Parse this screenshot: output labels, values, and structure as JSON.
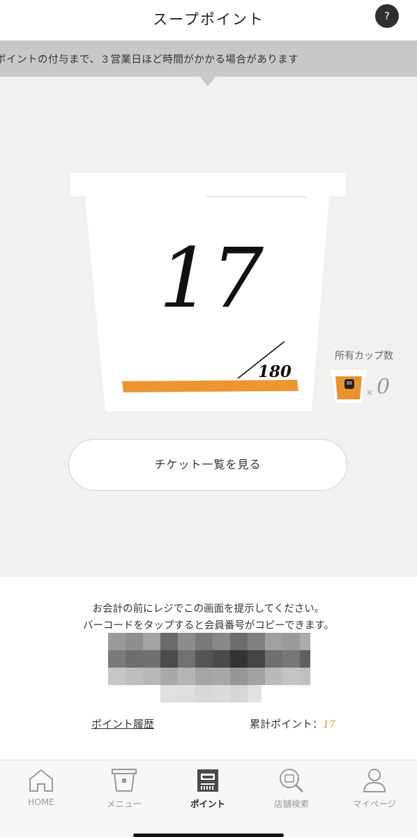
{
  "header": {
    "title": "スープポイント",
    "help_label": "?"
  },
  "notice": {
    "text": "ポイントの付与まで、３営業日ほど時間がかかる場合があります"
  },
  "points": {
    "current": "17",
    "goal": "180",
    "progress_fraction": 0.094
  },
  "cups": {
    "label": "所有カップ数",
    "multiplier": "×",
    "count": "0"
  },
  "ticket_button": {
    "label": "チケット一覧を見る"
  },
  "instruction": {
    "line1": "お会計の前にレジでこの画面を提示してください。",
    "line2": "バーコードをタップすると会員番号がコピーできます。"
  },
  "footer_links": {
    "history_label": "ポイント履歴",
    "total_label": "累計ポイント：",
    "total_value": "17"
  },
  "tabbar": {
    "items": [
      {
        "label": "HOME",
        "icon": "home-icon",
        "active": false
      },
      {
        "label": "メニュー",
        "icon": "cup-icon",
        "active": false
      },
      {
        "label": "ポイント",
        "icon": "register-icon",
        "active": true
      },
      {
        "label": "店舗検索",
        "icon": "store-search-icon",
        "active": false
      },
      {
        "label": "マイページ",
        "icon": "person-icon",
        "active": false
      }
    ]
  },
  "colors": {
    "accent": "#e8932e",
    "background": "#f1f1f0",
    "notice_bg": "#c8c8c8"
  }
}
